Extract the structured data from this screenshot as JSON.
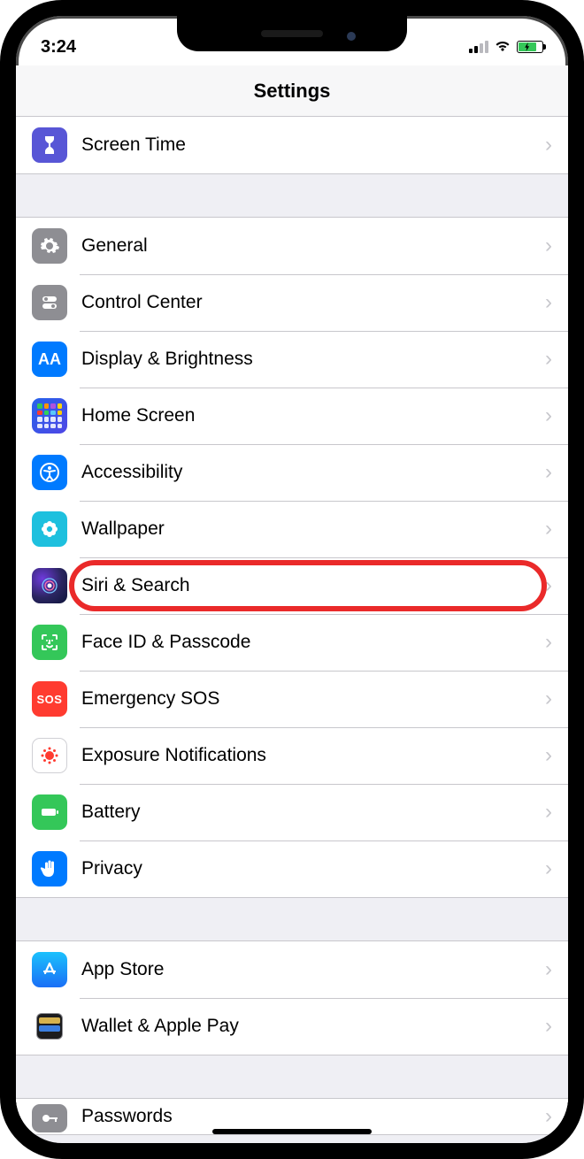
{
  "status": {
    "time": "3:24"
  },
  "header": {
    "title": "Settings"
  },
  "highlighted_item_id": "siri-search",
  "sections": [
    {
      "items": [
        {
          "id": "screen-time",
          "label": "Screen Time",
          "icon": "hourglass-icon",
          "bg": "bg-purple"
        }
      ]
    },
    {
      "items": [
        {
          "id": "general",
          "label": "General",
          "icon": "gear-icon",
          "bg": "bg-gray"
        },
        {
          "id": "control-center",
          "label": "Control Center",
          "icon": "switches-icon",
          "bg": "bg-gray"
        },
        {
          "id": "display-brightness",
          "label": "Display & Brightness",
          "icon": "text-size-icon",
          "bg": "bg-blue"
        },
        {
          "id": "home-screen",
          "label": "Home Screen",
          "icon": "apps-grid-icon",
          "bg": "bg-homescreen"
        },
        {
          "id": "accessibility",
          "label": "Accessibility",
          "icon": "accessibility-icon",
          "bg": "bg-blue"
        },
        {
          "id": "wallpaper",
          "label": "Wallpaper",
          "icon": "flower-icon",
          "bg": "bg-cyan"
        },
        {
          "id": "siri-search",
          "label": "Siri & Search",
          "icon": "siri-icon",
          "bg": "bg-siri"
        },
        {
          "id": "face-id-passcode",
          "label": "Face ID & Passcode",
          "icon": "faceid-icon",
          "bg": "bg-green"
        },
        {
          "id": "emergency-sos",
          "label": "Emergency SOS",
          "icon": "sos-icon",
          "bg": "bg-red"
        },
        {
          "id": "exposure-notifications",
          "label": "Exposure Notifications",
          "icon": "exposure-icon",
          "bg": "bg-white"
        },
        {
          "id": "battery",
          "label": "Battery",
          "icon": "battery-icon",
          "bg": "bg-green"
        },
        {
          "id": "privacy",
          "label": "Privacy",
          "icon": "hand-icon",
          "bg": "bg-blue"
        }
      ]
    },
    {
      "items": [
        {
          "id": "app-store",
          "label": "App Store",
          "icon": "appstore-icon",
          "bg": "bg-appstore"
        },
        {
          "id": "wallet-apple-pay",
          "label": "Wallet & Apple Pay",
          "icon": "wallet-icon",
          "bg": "bg-dark"
        }
      ]
    },
    {
      "items": [
        {
          "id": "passwords",
          "label": "Passwords",
          "icon": "key-icon",
          "bg": "bg-gray"
        }
      ]
    }
  ]
}
